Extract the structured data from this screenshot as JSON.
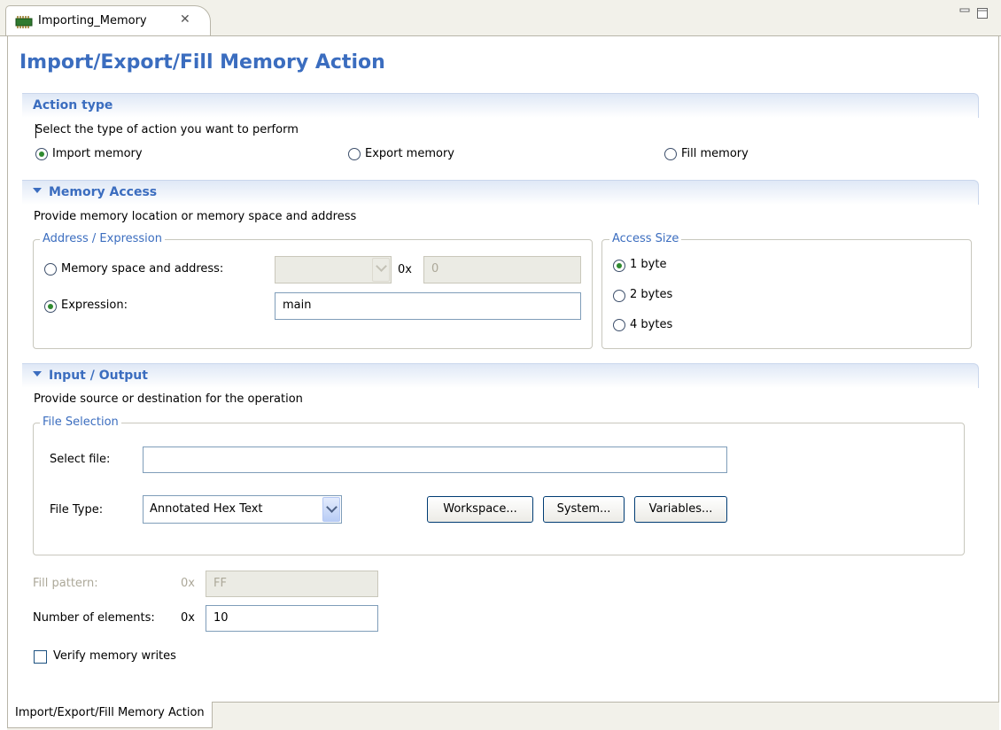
{
  "tab": {
    "label": "Importing_Memory",
    "icon": "memory-chip-icon",
    "close_icon": "close-icon"
  },
  "window_controls": {
    "minimize_icon": "minimize-icon",
    "maximize_icon": "maximize-icon"
  },
  "page_title": "Import/Export/Fill Memory Action",
  "action_type": {
    "title": "Action type",
    "description": "Select the type of action you want to perform",
    "options": [
      {
        "label": "Import memory",
        "checked": true
      },
      {
        "label": "Export memory",
        "checked": false
      },
      {
        "label": "Fill memory",
        "checked": false
      }
    ]
  },
  "memory_access": {
    "title": "Memory Access",
    "description": "Provide memory location or memory space and address",
    "address_group": {
      "title": "Address / Expression",
      "memory_space_label": "Memory space and address:",
      "hex_prefix": "0x",
      "address_value": "0",
      "expression_label": "Expression:",
      "expression_value": "main",
      "selected": "expression"
    },
    "access_size": {
      "title": "Access Size",
      "options": [
        {
          "label": "1 byte",
          "checked": true
        },
        {
          "label": "2 bytes",
          "checked": false
        },
        {
          "label": "4 bytes",
          "checked": false
        }
      ]
    }
  },
  "input_output": {
    "title": "Input / Output",
    "description": "Provide source or destination for the operation",
    "file_selection": {
      "title": "File Selection",
      "select_file_label": "Select file:",
      "select_file_value": "",
      "file_type_label": "File Type:",
      "file_type_value": "Annotated Hex Text",
      "buttons": {
        "workspace": "Workspace...",
        "system": "System...",
        "variables": "Variables..."
      }
    }
  },
  "fill_pattern": {
    "label": "Fill pattern:",
    "prefix": "0x",
    "value": "FF",
    "enabled": false
  },
  "number_of_elements": {
    "label": "Number of elements:",
    "prefix": "0x",
    "value": "10"
  },
  "verify": {
    "label": "Verify memory writes",
    "checked": false
  },
  "bottom_tab": {
    "label": "Import/Export/Fill Memory Action"
  },
  "colors": {
    "accent": "#3b6dbf",
    "section_gradient": "#dfe8f6",
    "radio_dot": "#2f8a2f"
  }
}
